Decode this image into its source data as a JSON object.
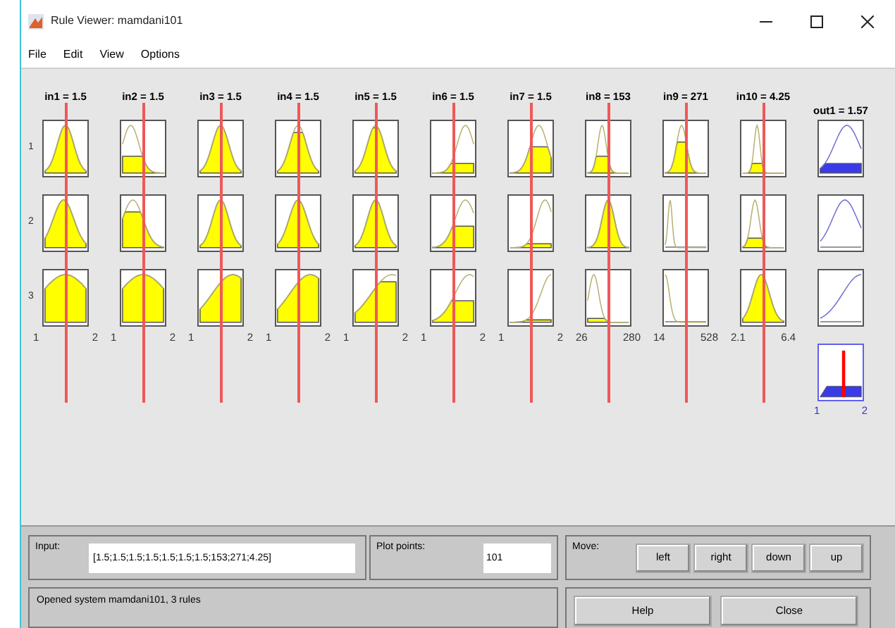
{
  "window": {
    "title": "Rule Viewer: mamdani101"
  },
  "menu": [
    "File",
    "Edit",
    "View",
    "Options"
  ],
  "rule_numbers": [
    "1",
    "2",
    "3"
  ],
  "inputs": [
    {
      "label": "in1 = 1.5",
      "range": [
        "1",
        "2"
      ],
      "rules": [
        {
          "level": 1
        },
        {
          "level": 1
        },
        {
          "level": 1
        }
      ]
    },
    {
      "label": "in2 = 1.5",
      "range": [
        "1",
        "2"
      ],
      "rules": [
        {
          "level": 0.35
        },
        {
          "level": 0.75
        },
        {
          "level": 1
        }
      ]
    },
    {
      "label": "in3 = 1.5",
      "range": [
        "1",
        "2"
      ],
      "rules": [
        {
          "level": 1
        },
        {
          "level": 1
        },
        {
          "level": 1
        }
      ]
    },
    {
      "label": "in4 = 1.5",
      "range": [
        "1",
        "2"
      ],
      "rules": [
        {
          "level": 0.85
        },
        {
          "level": 1
        },
        {
          "level": 1
        }
      ]
    },
    {
      "label": "in5 = 1.5",
      "range": [
        "1",
        "2"
      ],
      "rules": [
        {
          "level": 0.95
        },
        {
          "level": 1
        },
        {
          "level": 0.85
        }
      ]
    },
    {
      "label": "in6 = 1.5",
      "range": [
        "1",
        "2"
      ],
      "rules": [
        {
          "level": 0.2
        },
        {
          "level": 0.45
        },
        {
          "level": 0.45
        }
      ]
    },
    {
      "label": "in7 = 1.5",
      "range": [
        "1",
        "2"
      ],
      "rules": [
        {
          "level": 0.55
        },
        {
          "level": 0.08
        },
        {
          "level": 0.05
        }
      ]
    },
    {
      "label": "in8 = 153",
      "range": [
        "26",
        "280"
      ],
      "rules": [
        {
          "level": 0.35
        },
        {
          "level": 1
        },
        {
          "level": 0.08
        }
      ]
    },
    {
      "label": "in9 = 271",
      "range": [
        "14",
        "528"
      ],
      "rules": [
        {
          "level": 0.65
        },
        {
          "level": 0
        },
        {
          "level": 0
        }
      ]
    },
    {
      "label": "in10 = 4.25",
      "range": [
        "2.1",
        "6.4"
      ],
      "rules": [
        {
          "level": 0.2
        },
        {
          "level": 0.2
        },
        {
          "level": 1
        }
      ]
    }
  ],
  "output": {
    "label": "out1 = 1.57",
    "rules": [
      {
        "level": 0.2
      },
      {
        "level": 0
      },
      {
        "level": 0
      }
    ],
    "aggregate": {
      "level": 0.57
    },
    "range": [
      "1",
      "2"
    ]
  },
  "input_panel": {
    "label": "Input:",
    "value": "[1.5;1.5;1.5;1.5;1.5;1.5;1.5;153;271;4.25]"
  },
  "plot_points": {
    "label": "Plot points:",
    "value": "101"
  },
  "move": {
    "label": "Move:",
    "buttons": [
      "left",
      "right",
      "down",
      "up"
    ]
  },
  "status": "Opened system mamdani101, 3 rules",
  "buttons": [
    "Help",
    "Close"
  ]
}
